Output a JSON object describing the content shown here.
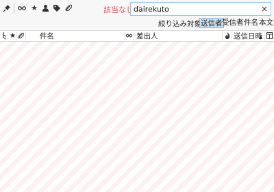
{
  "toolbar": {
    "icons": [
      "pin-icon",
      "thread-icon",
      "star-icon",
      "contact-icon",
      "tag-icon",
      "attachment-icon"
    ],
    "no_match_text": "該当なし",
    "search_value": "dairekuto",
    "clear_glyph": "×"
  },
  "filter": {
    "label": "絞り込み対象:",
    "options": [
      {
        "label": "送信者",
        "active": true
      },
      {
        "label": "受信者",
        "active": false
      },
      {
        "label": "件名",
        "active": false
      },
      {
        "label": "本文",
        "active": false
      }
    ]
  },
  "columns": {
    "subject": "件名",
    "sender": "差出人",
    "date": "送信日時",
    "sort_indicator": "▲"
  },
  "colors": {
    "no_match": "#e05555",
    "active_filter_bg": "#cde4f7",
    "stripe": "#fdf0f2"
  }
}
